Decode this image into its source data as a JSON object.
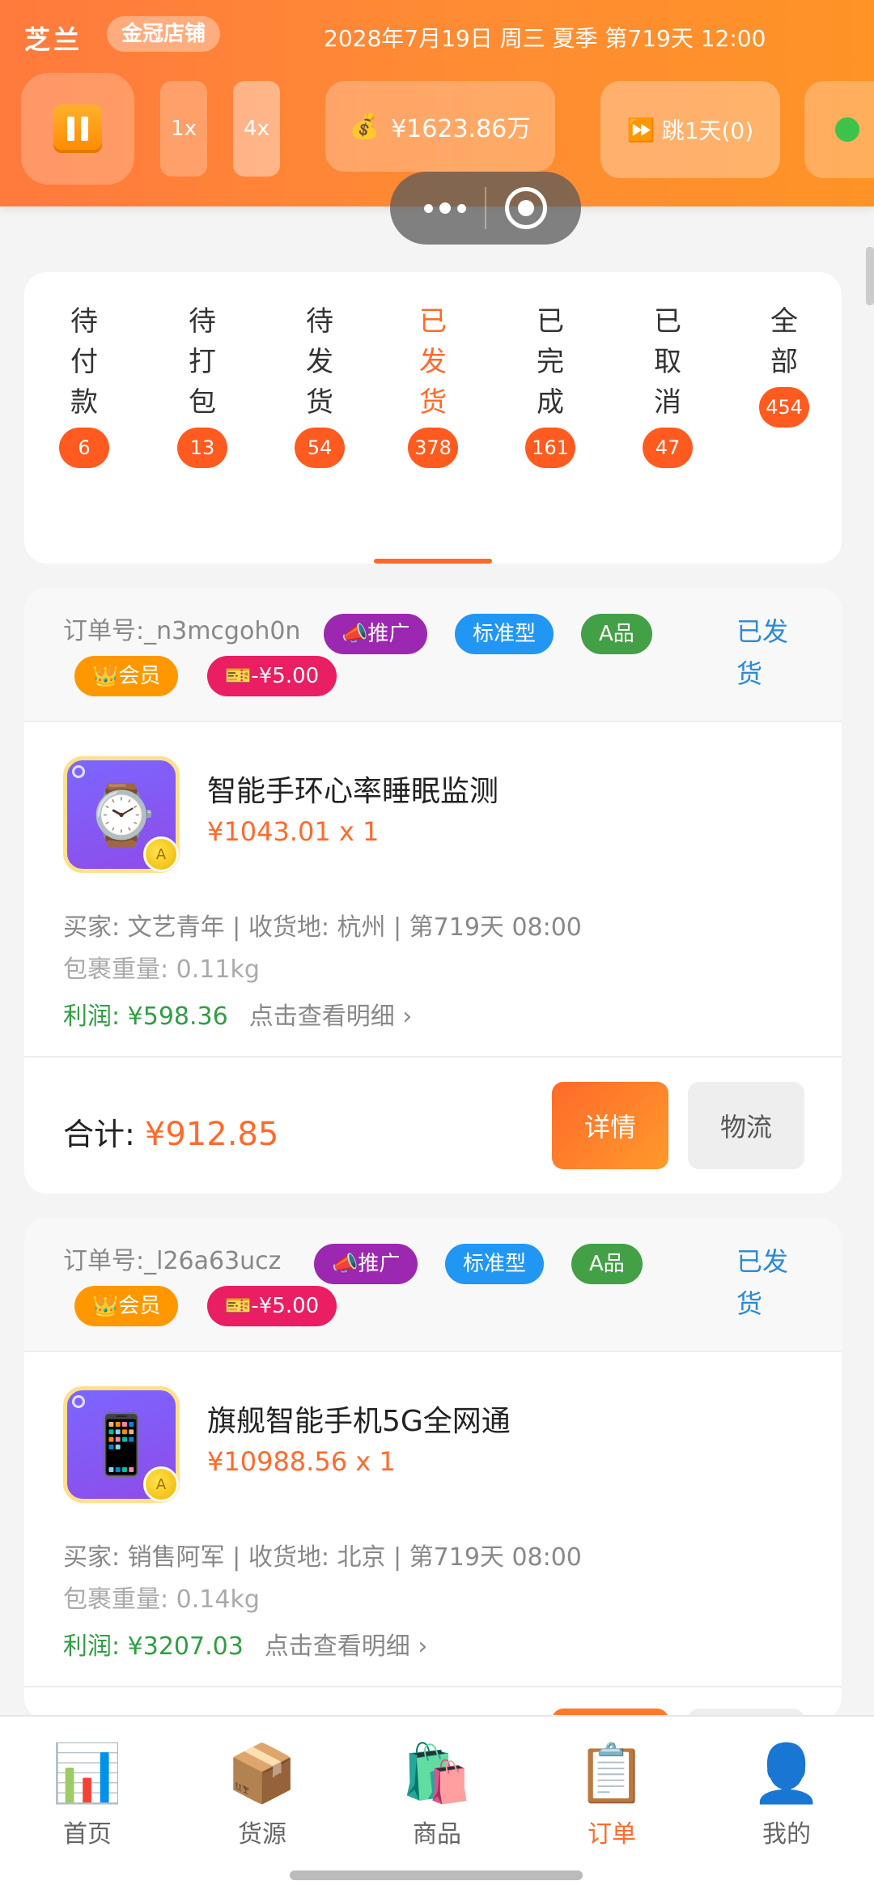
{
  "header": {
    "region": "芝兰",
    "shop_badge": "金冠店铺",
    "datetime": "2028年7月19日 周三 夏季 第719天 12:00",
    "speed_1x": "1x",
    "speed_4x": "4x",
    "money_icon": "💰",
    "money": "¥1623.86万",
    "skip_icon": "⏩",
    "skip_label": "跳1天(0)"
  },
  "tabs": [
    {
      "label": "待付款",
      "count": "6"
    },
    {
      "label": "待打包",
      "count": "13"
    },
    {
      "label": "待发货",
      "count": "54"
    },
    {
      "label": "已发货",
      "count": "378"
    },
    {
      "label": "已完成",
      "count": "161"
    },
    {
      "label": "已取消",
      "count": "47"
    },
    {
      "label": "全部",
      "count": "454"
    }
  ],
  "active_tab": "已发货",
  "orders": [
    {
      "order_no": "订单号:_n3mcgoh0n",
      "tags": {
        "promo": "📣推广",
        "std": "标准型",
        "grade": "A品",
        "vip": "👑会员",
        "coupon": "🎫-¥5.00"
      },
      "status": "已发货",
      "product_icon": "⌚",
      "product_name": "智能手环心率睡眠监测",
      "product_price": "¥1043.01 x 1",
      "buyer": "买家: 文艺青年 | 收货地: 杭州 | 第719天 08:00",
      "weight": "包裹重量: 0.11kg",
      "profit": "利润: ¥598.36",
      "profit_hint": "点击查看明细 ›",
      "total_label": "合计: ",
      "total": "¥912.85",
      "detail_btn": "详情",
      "logistics_btn": "物流"
    },
    {
      "order_no": "订单号:_l26a63ucz",
      "tags": {
        "promo": "📣推广",
        "std": "标准型",
        "grade": "A品",
        "vip": "👑会员",
        "coupon": "🎫-¥5.00"
      },
      "status": "已发货",
      "product_icon": "📱",
      "product_name": "旗舰智能手机5G全网通",
      "product_price": "¥10988.56 x 1",
      "buyer": "买家: 销售阿军 | 收货地: 北京 | 第719天 08:00",
      "weight": "包裹重量: 0.14kg",
      "profit": "利润: ¥3207.03",
      "profit_hint": "点击查看明细 ›"
    }
  ],
  "nav": [
    {
      "icon": "📊",
      "label": "首页"
    },
    {
      "icon": "📦",
      "label": "货源"
    },
    {
      "icon": "🛍️",
      "label": "商品"
    },
    {
      "icon": "📋",
      "label": "订单"
    },
    {
      "icon": "👤",
      "label": "我的"
    }
  ],
  "colors": {
    "accent": "#ff6a2b",
    "status_blue": "#2a8ad8",
    "profit_green": "#2f9e44"
  }
}
